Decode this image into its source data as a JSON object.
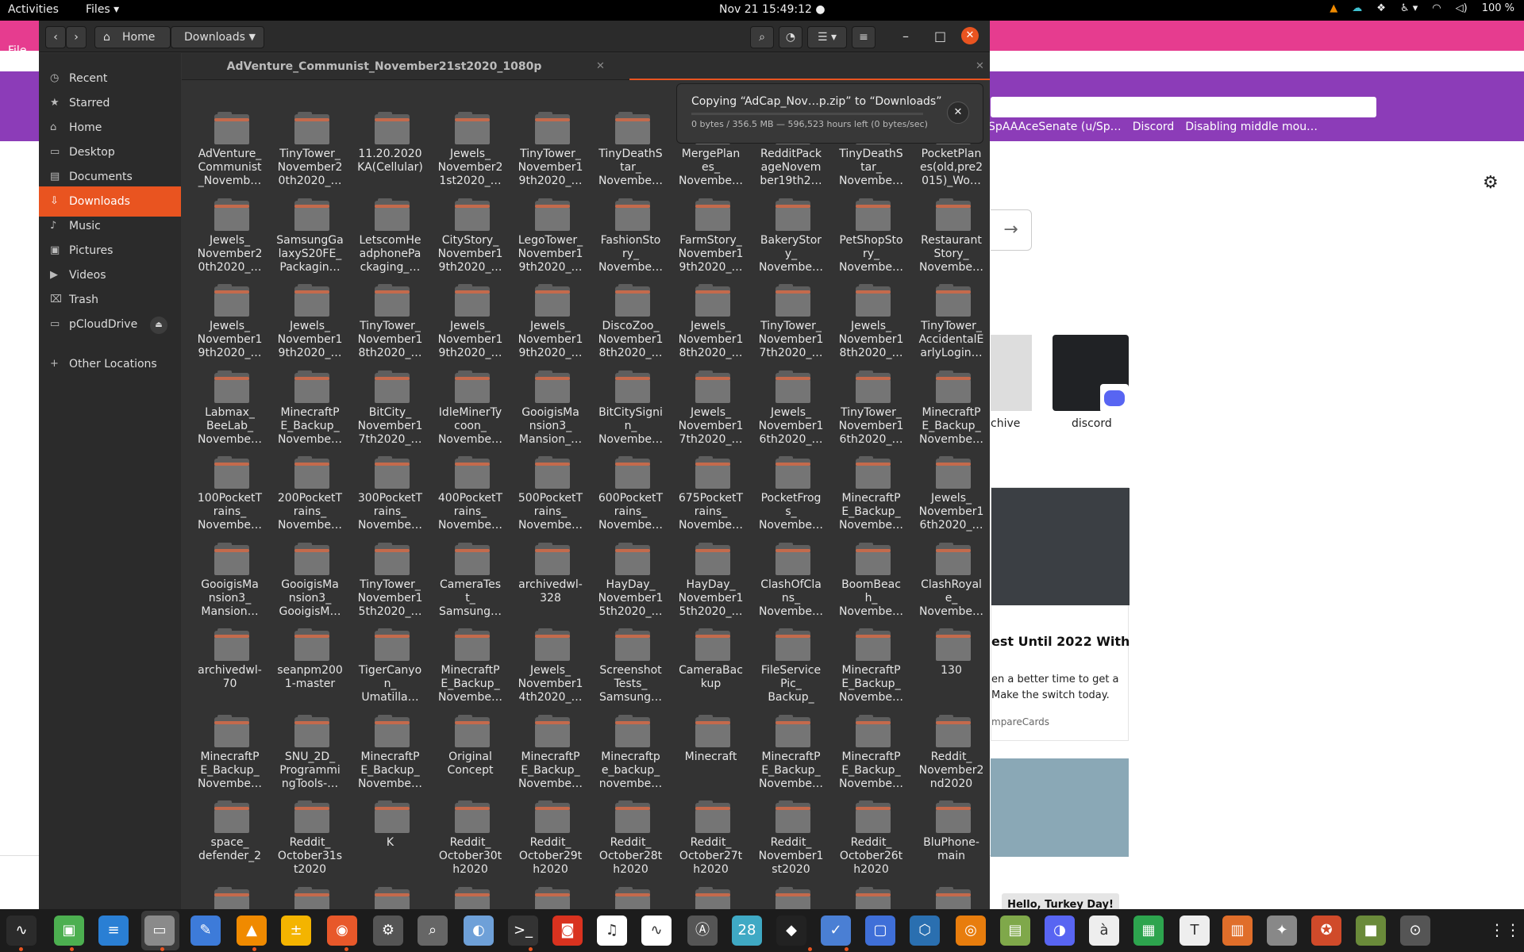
{
  "topbar": {
    "activities": "Activities",
    "app_menu": "Files ▾",
    "clock": "Nov 21  15:49:12  ●",
    "battery": "100 %"
  },
  "browser": {
    "menu_file": "File",
    "bookmarks": [
      "SpAAAceSenate (u/Sp…",
      "Discord",
      "Disabling middle mou…"
    ],
    "tile_archive": "chive",
    "tile_discord": "discord",
    "card_title": "est Until 2022 With",
    "card_text": "en a better time to get a Make the switch today.",
    "card_source": "mpareCards",
    "hello_button": "Hello, Turkey Day!"
  },
  "files": {
    "nav_home": "Home",
    "nav_downloads": "Downloads",
    "sidebar": [
      {
        "label": "Recent",
        "icon": "clock-icon"
      },
      {
        "label": "Starred",
        "icon": "star-icon"
      },
      {
        "label": "Home",
        "icon": "home-icon"
      },
      {
        "label": "Desktop",
        "icon": "desktop-icon"
      },
      {
        "label": "Documents",
        "icon": "document-icon"
      },
      {
        "label": "Downloads",
        "icon": "download-icon"
      },
      {
        "label": "Music",
        "icon": "music-icon"
      },
      {
        "label": "Pictures",
        "icon": "picture-icon"
      },
      {
        "label": "Videos",
        "icon": "video-icon"
      },
      {
        "label": "Trash",
        "icon": "trash-icon"
      },
      {
        "label": "pCloudDrive",
        "icon": "drive-icon"
      },
      {
        "label": "Other Locations",
        "icon": "plus-icon"
      }
    ],
    "tab_label": "AdVenture_Communist_November21st2020_1080p",
    "copy": {
      "title": "Copying “AdCap_Nov…p.zip” to “Downloads”",
      "detail": "0 bytes / 356.5 MB — 596,523 hours left (0 bytes/sec)"
    },
    "folders": [
      "AdVenture_\nCommunist\n_Novemb…",
      "TinyTower_\nNovember2\n0th2020_…",
      "11.20.2020\nKA(Cellular)",
      "Jewels_\nNovember2\n1st2020_…",
      "TinyTower_\nNovember1\n9th2020_…",
      "TinyDeathS\ntar_\nNovembe…",
      "MergePlan\nes_\nNovembe…",
      "RedditPack\nageNovem\nber19th2…",
      "TinyDeathS\ntar_\nNovembe…",
      "PocketPlan\nes(old,pre2\n015)_Wo…",
      "Jewels_\nNovember2\n0th2020_…",
      "SamsungGa\nlaxyS20FE_\nPackagin…",
      "LetscomHe\nadphonePa\nckaging_…",
      "CityStory_\nNovember1\n9th2020_…",
      "LegoTower_\nNovember1\n9th2020_…",
      "FashionSto\nry_\nNovembe…",
      "FarmStory_\nNovember1\n9th2020_…",
      "BakeryStor\ny_\nNovembe…",
      "PetShopSto\nry_\nNovembe…",
      "Restaurant\nStory_\nNovembe…",
      "Jewels_\nNovember1\n9th2020_…",
      "Jewels_\nNovember1\n9th2020_…",
      "TinyTower_\nNovember1\n8th2020_…",
      "Jewels_\nNovember1\n9th2020_…",
      "Jewels_\nNovember1\n9th2020_…",
      "DiscoZoo_\nNovember1\n8th2020_…",
      "Jewels_\nNovember1\n8th2020_…",
      "TinyTower_\nNovember1\n7th2020_…",
      "Jewels_\nNovember1\n8th2020_…",
      "TinyTower_\nAccidentalE\narlyLogin…",
      "Labmax_\nBeeLab_\nNovembe…",
      "MinecraftP\nE_Backup_\nNovembe…",
      "BitCity_\nNovember1\n7th2020_…",
      "IdleMinerTy\ncoon_\nNovembe…",
      "GooigisMa\nnsion3_\nMansion_…",
      "BitCitySigni\nn_\nNovembe…",
      "Jewels_\nNovember1\n7th2020_…",
      "Jewels_\nNovember1\n6th2020_…",
      "TinyTower_\nNovember1\n6th2020_…",
      "MinecraftP\nE_Backup_\nNovembe…",
      "100PocketT\nrains_\nNovembe…",
      "200PocketT\nrains_\nNovembe…",
      "300PocketT\nrains_\nNovembe…",
      "400PocketT\nrains_\nNovembe…",
      "500PocketT\nrains_\nNovembe…",
      "600PocketT\nrains_\nNovembe…",
      "675PocketT\nrains_\nNovembe…",
      "PocketFrog\ns_\nNovembe…",
      "MinecraftP\nE_Backup_\nNovembe…",
      "Jewels_\nNovember1\n6th2020_…",
      "GooigisMa\nnsion3_\nMansion…",
      "GooigisMa\nnsion3_\nGooigisM…",
      "TinyTower_\nNovember1\n5th2020_…",
      "CameraTes\nt_\nSamsung…",
      "archivedwl-\n328",
      "HayDay_\nNovember1\n5th2020_…",
      "HayDay_\nNovember1\n5th2020_…",
      "ClashOfCla\nns_\nNovembe…",
      "BoomBeac\nh_\nNovembe…",
      "ClashRoyal\ne_\nNovembe…",
      "archivedwl-\n70",
      "seanpm200\n1-master",
      "TigerCanyo\nn_\nUmatilla…",
      "MinecraftP\nE_Backup_\nNovembe…",
      "Jewels_\nNovember1\n4th2020_…",
      "Screenshot\nTests_\nSamsung…",
      "CameraBac\nkup",
      "FileService\nPic_\nBackup_",
      "MinecraftP\nE_Backup_\nNovembe…",
      "130",
      "MinecraftP\nE_Backup_\nNovembe…",
      "SNU_2D_\nProgrammi\nngTools-…",
      "MinecraftP\nE_Backup_\nNovembe…",
      "Original\nConcept",
      "MinecraftP\nE_Backup_\nNovembe…",
      "Minecraftp\ne_backup_\nnovembe…",
      "Minecraft",
      "MinecraftP\nE_Backup_\nNovembe…",
      "MinecraftP\nE_Backup_\nNovembe…",
      "Reddit_\nNovember2\nnd2020",
      "space_\ndefender_2",
      "Reddit_\nOctober31s\nt2020",
      "K",
      "Reddit_\nOctober30t\nh2020",
      "Reddit_\nOctober29t\nh2020",
      "Reddit_\nOctober28t\nh2020",
      "Reddit_\nOctober27t\nh2020",
      "Reddit_\nNovember1\nst2020",
      "Reddit_\nOctober26t\nh2020",
      "BluPhone-\nmain",
      "",
      "",
      "",
      "",
      "",
      "",
      "",
      "",
      "",
      ""
    ]
  },
  "dock": {
    "apps": [
      {
        "icon": "system-monitor-icon",
        "glyph": "∿",
        "color": "#2b2b2b"
      },
      {
        "icon": "tweaks-icon",
        "glyph": "▣",
        "color": "#4caf50"
      },
      {
        "icon": "writer-icon",
        "glyph": "≡",
        "color": "#2a7fd4"
      },
      {
        "icon": "files-icon",
        "glyph": "▭",
        "color": "#8a8a8a"
      },
      {
        "icon": "text-editor-icon",
        "glyph": "✎",
        "color": "#3d7bd9"
      },
      {
        "icon": "vlc-icon",
        "glyph": "▲",
        "color": "#f08a00"
      },
      {
        "icon": "calculator-icon",
        "glyph": "±",
        "color": "#f4b400"
      },
      {
        "icon": "firefox-icon",
        "glyph": "◉",
        "color": "#e8582a"
      },
      {
        "icon": "settings-icon",
        "glyph": "⚙",
        "color": "#555"
      },
      {
        "icon": "magnifier-icon",
        "glyph": "⌕",
        "color": "#666"
      },
      {
        "icon": "image-viewer-icon",
        "glyph": "◐",
        "color": "#6ea0d8"
      },
      {
        "icon": "terminal-icon",
        "glyph": ">_",
        "color": "#333"
      },
      {
        "icon": "screenshot-icon",
        "glyph": "◙",
        "color": "#d9321f"
      },
      {
        "icon": "audio-icon",
        "glyph": "♫",
        "color": "#fff"
      },
      {
        "icon": "usage-icon",
        "glyph": "∿",
        "color": "#fff"
      },
      {
        "icon": "software-icon",
        "glyph": "Ⓐ",
        "color": "#555"
      },
      {
        "icon": "calendar-icon",
        "glyph": "28",
        "color": "#3fa9c4"
      },
      {
        "icon": "inkscape-icon",
        "glyph": "◆",
        "color": "#222"
      },
      {
        "icon": "tasks-icon",
        "glyph": "✓",
        "color": "#4a7fd4"
      },
      {
        "icon": "screen-capture-icon",
        "glyph": "▢",
        "color": "#3f6fd8"
      },
      {
        "icon": "virtualbox-icon",
        "glyph": "⬡",
        "color": "#2a6fb0"
      },
      {
        "icon": "blender-icon",
        "glyph": "◎",
        "color": "#e87d0d"
      },
      {
        "icon": "image-editor-icon",
        "glyph": "▤",
        "color": "#7fa84a"
      },
      {
        "icon": "discord-icon",
        "glyph": "◑",
        "color": "#5865f2"
      },
      {
        "icon": "document-viewer-icon",
        "glyph": "à",
        "color": "#eee"
      },
      {
        "icon": "spreadsheet-icon",
        "glyph": "▦",
        "color": "#2da44e"
      },
      {
        "icon": "typora-icon",
        "glyph": "T",
        "color": "#eee"
      },
      {
        "icon": "presentation-icon",
        "glyph": "▥",
        "color": "#e06e2a"
      },
      {
        "icon": "tools-icon",
        "glyph": "✦",
        "color": "#888"
      },
      {
        "icon": "game-icon",
        "glyph": "✪",
        "color": "#d04a2a"
      },
      {
        "icon": "minecraft-icon",
        "glyph": "■",
        "color": "#6a8a3a"
      },
      {
        "icon": "maps-icon",
        "glyph": "⊙",
        "color": "#555"
      }
    ]
  }
}
